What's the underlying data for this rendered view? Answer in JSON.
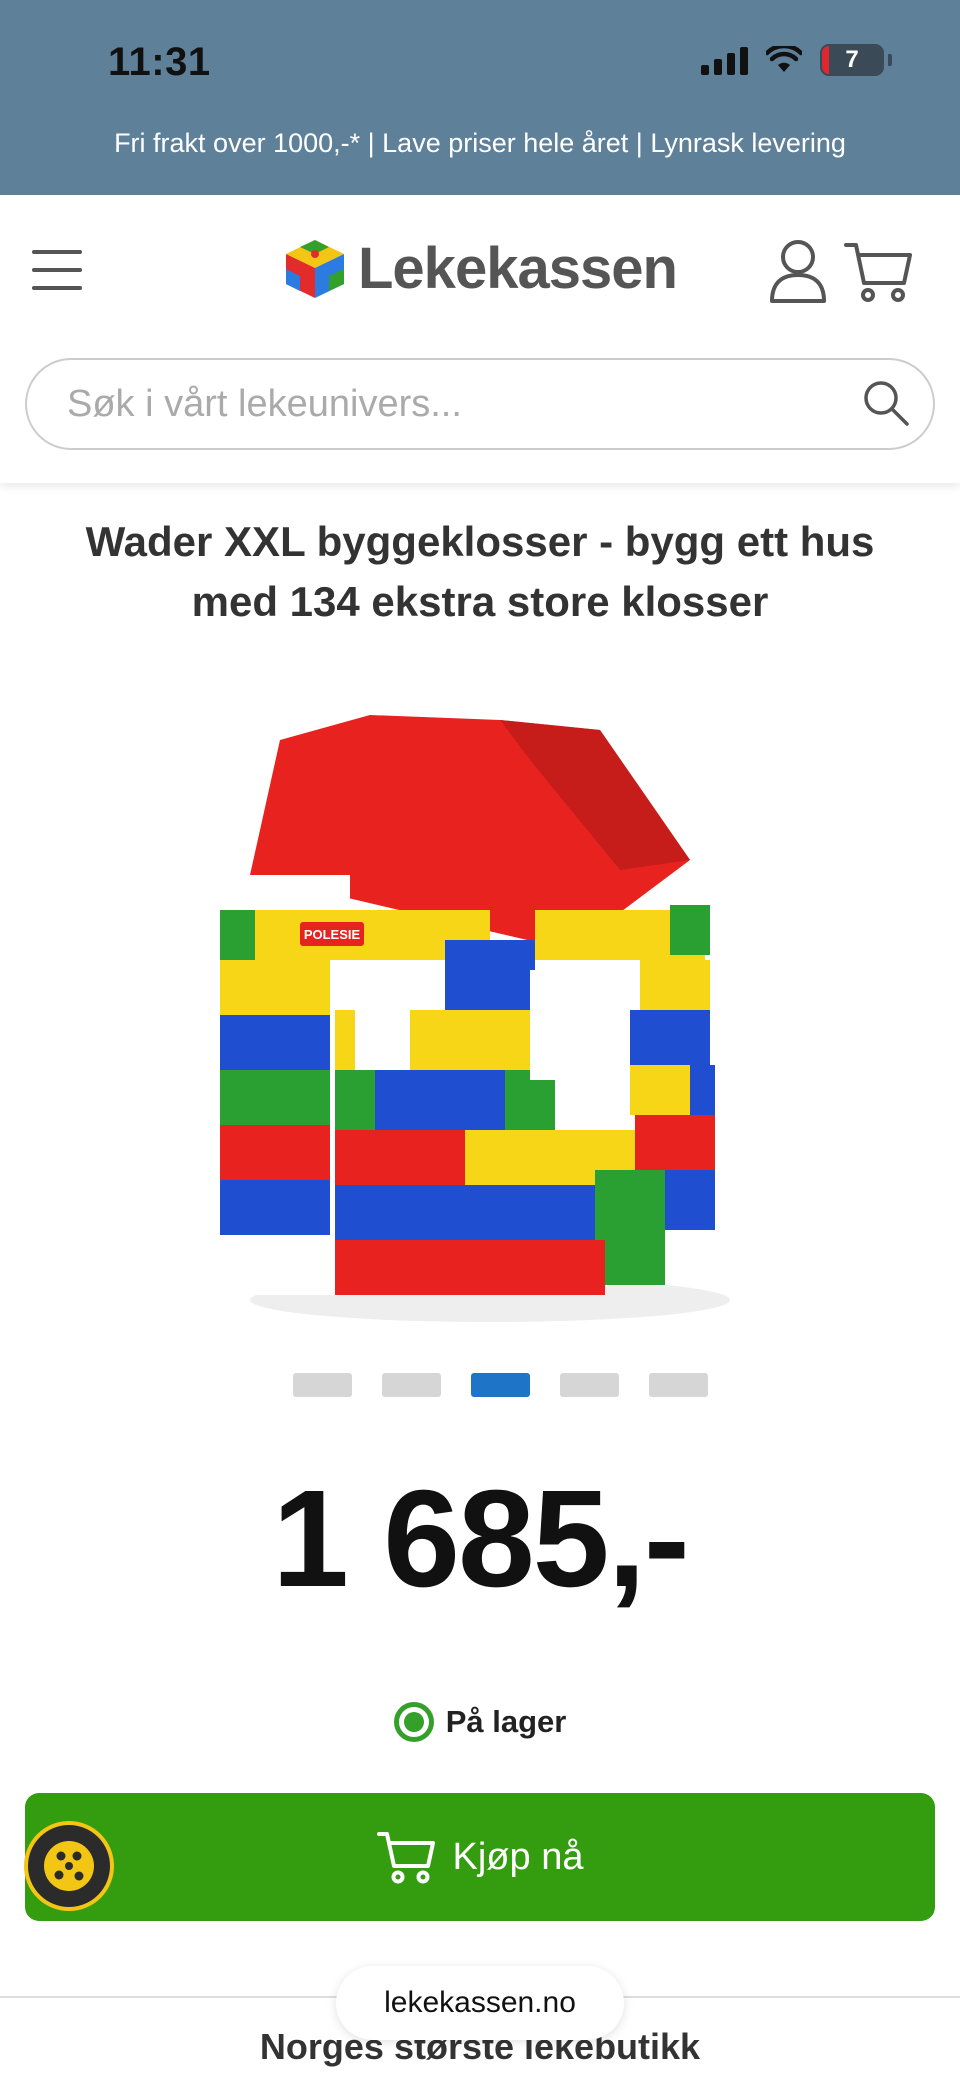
{
  "status_bar": {
    "time": "11:31",
    "battery_level": "7"
  },
  "promo": {
    "text": "Fri frakt over 1000,-* | Lave priser hele året | Lynrask levering"
  },
  "header": {
    "logo_text": "Lekekassen",
    "menu_icon": "hamburger-icon",
    "account_icon": "user-icon",
    "cart_icon": "cart-icon"
  },
  "search": {
    "placeholder": "Søk i vårt lekeunivers...",
    "icon": "search-icon"
  },
  "product": {
    "title": "Wader XXL byggeklosser - bygg ett hus med 134 ekstra store klosser",
    "image_label": "POLESIE",
    "gallery": {
      "count": 5,
      "active_index": 2
    },
    "price": "1 685,-",
    "stock_text": "På lager",
    "buy_label": "Kjøp nå"
  },
  "footer": {
    "tagline": "Norges største lekebutikk"
  },
  "browser": {
    "url": "lekekassen.no"
  },
  "colors": {
    "top_band": "#5f8099",
    "buy_button": "#339c0f",
    "active_dot": "#1e74c6",
    "stock_green": "#34a02b"
  }
}
